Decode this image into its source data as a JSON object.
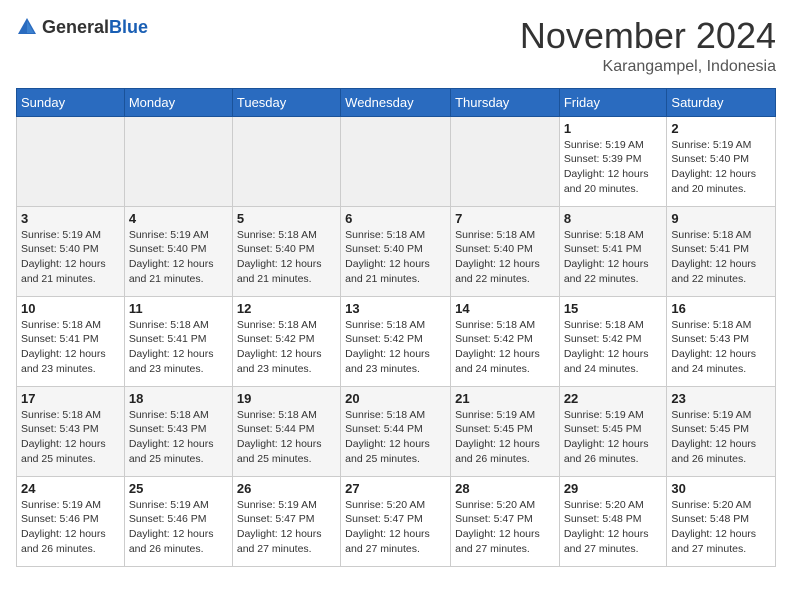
{
  "logo": {
    "text_general": "General",
    "text_blue": "Blue"
  },
  "title": "November 2024",
  "subtitle": "Karangampel, Indonesia",
  "days_of_week": [
    "Sunday",
    "Monday",
    "Tuesday",
    "Wednesday",
    "Thursday",
    "Friday",
    "Saturday"
  ],
  "weeks": [
    [
      {
        "day": "",
        "info": ""
      },
      {
        "day": "",
        "info": ""
      },
      {
        "day": "",
        "info": ""
      },
      {
        "day": "",
        "info": ""
      },
      {
        "day": "",
        "info": ""
      },
      {
        "day": "1",
        "info": "Sunrise: 5:19 AM\nSunset: 5:39 PM\nDaylight: 12 hours and 20 minutes."
      },
      {
        "day": "2",
        "info": "Sunrise: 5:19 AM\nSunset: 5:40 PM\nDaylight: 12 hours and 20 minutes."
      }
    ],
    [
      {
        "day": "3",
        "info": "Sunrise: 5:19 AM\nSunset: 5:40 PM\nDaylight: 12 hours and 21 minutes."
      },
      {
        "day": "4",
        "info": "Sunrise: 5:19 AM\nSunset: 5:40 PM\nDaylight: 12 hours and 21 minutes."
      },
      {
        "day": "5",
        "info": "Sunrise: 5:18 AM\nSunset: 5:40 PM\nDaylight: 12 hours and 21 minutes."
      },
      {
        "day": "6",
        "info": "Sunrise: 5:18 AM\nSunset: 5:40 PM\nDaylight: 12 hours and 21 minutes."
      },
      {
        "day": "7",
        "info": "Sunrise: 5:18 AM\nSunset: 5:40 PM\nDaylight: 12 hours and 22 minutes."
      },
      {
        "day": "8",
        "info": "Sunrise: 5:18 AM\nSunset: 5:41 PM\nDaylight: 12 hours and 22 minutes."
      },
      {
        "day": "9",
        "info": "Sunrise: 5:18 AM\nSunset: 5:41 PM\nDaylight: 12 hours and 22 minutes."
      }
    ],
    [
      {
        "day": "10",
        "info": "Sunrise: 5:18 AM\nSunset: 5:41 PM\nDaylight: 12 hours and 23 minutes."
      },
      {
        "day": "11",
        "info": "Sunrise: 5:18 AM\nSunset: 5:41 PM\nDaylight: 12 hours and 23 minutes."
      },
      {
        "day": "12",
        "info": "Sunrise: 5:18 AM\nSunset: 5:42 PM\nDaylight: 12 hours and 23 minutes."
      },
      {
        "day": "13",
        "info": "Sunrise: 5:18 AM\nSunset: 5:42 PM\nDaylight: 12 hours and 23 minutes."
      },
      {
        "day": "14",
        "info": "Sunrise: 5:18 AM\nSunset: 5:42 PM\nDaylight: 12 hours and 24 minutes."
      },
      {
        "day": "15",
        "info": "Sunrise: 5:18 AM\nSunset: 5:42 PM\nDaylight: 12 hours and 24 minutes."
      },
      {
        "day": "16",
        "info": "Sunrise: 5:18 AM\nSunset: 5:43 PM\nDaylight: 12 hours and 24 minutes."
      }
    ],
    [
      {
        "day": "17",
        "info": "Sunrise: 5:18 AM\nSunset: 5:43 PM\nDaylight: 12 hours and 25 minutes."
      },
      {
        "day": "18",
        "info": "Sunrise: 5:18 AM\nSunset: 5:43 PM\nDaylight: 12 hours and 25 minutes."
      },
      {
        "day": "19",
        "info": "Sunrise: 5:18 AM\nSunset: 5:44 PM\nDaylight: 12 hours and 25 minutes."
      },
      {
        "day": "20",
        "info": "Sunrise: 5:18 AM\nSunset: 5:44 PM\nDaylight: 12 hours and 25 minutes."
      },
      {
        "day": "21",
        "info": "Sunrise: 5:19 AM\nSunset: 5:45 PM\nDaylight: 12 hours and 26 minutes."
      },
      {
        "day": "22",
        "info": "Sunrise: 5:19 AM\nSunset: 5:45 PM\nDaylight: 12 hours and 26 minutes."
      },
      {
        "day": "23",
        "info": "Sunrise: 5:19 AM\nSunset: 5:45 PM\nDaylight: 12 hours and 26 minutes."
      }
    ],
    [
      {
        "day": "24",
        "info": "Sunrise: 5:19 AM\nSunset: 5:46 PM\nDaylight: 12 hours and 26 minutes."
      },
      {
        "day": "25",
        "info": "Sunrise: 5:19 AM\nSunset: 5:46 PM\nDaylight: 12 hours and 26 minutes."
      },
      {
        "day": "26",
        "info": "Sunrise: 5:19 AM\nSunset: 5:47 PM\nDaylight: 12 hours and 27 minutes."
      },
      {
        "day": "27",
        "info": "Sunrise: 5:20 AM\nSunset: 5:47 PM\nDaylight: 12 hours and 27 minutes."
      },
      {
        "day": "28",
        "info": "Sunrise: 5:20 AM\nSunset: 5:47 PM\nDaylight: 12 hours and 27 minutes."
      },
      {
        "day": "29",
        "info": "Sunrise: 5:20 AM\nSunset: 5:48 PM\nDaylight: 12 hours and 27 minutes."
      },
      {
        "day": "30",
        "info": "Sunrise: 5:20 AM\nSunset: 5:48 PM\nDaylight: 12 hours and 27 minutes."
      }
    ]
  ]
}
